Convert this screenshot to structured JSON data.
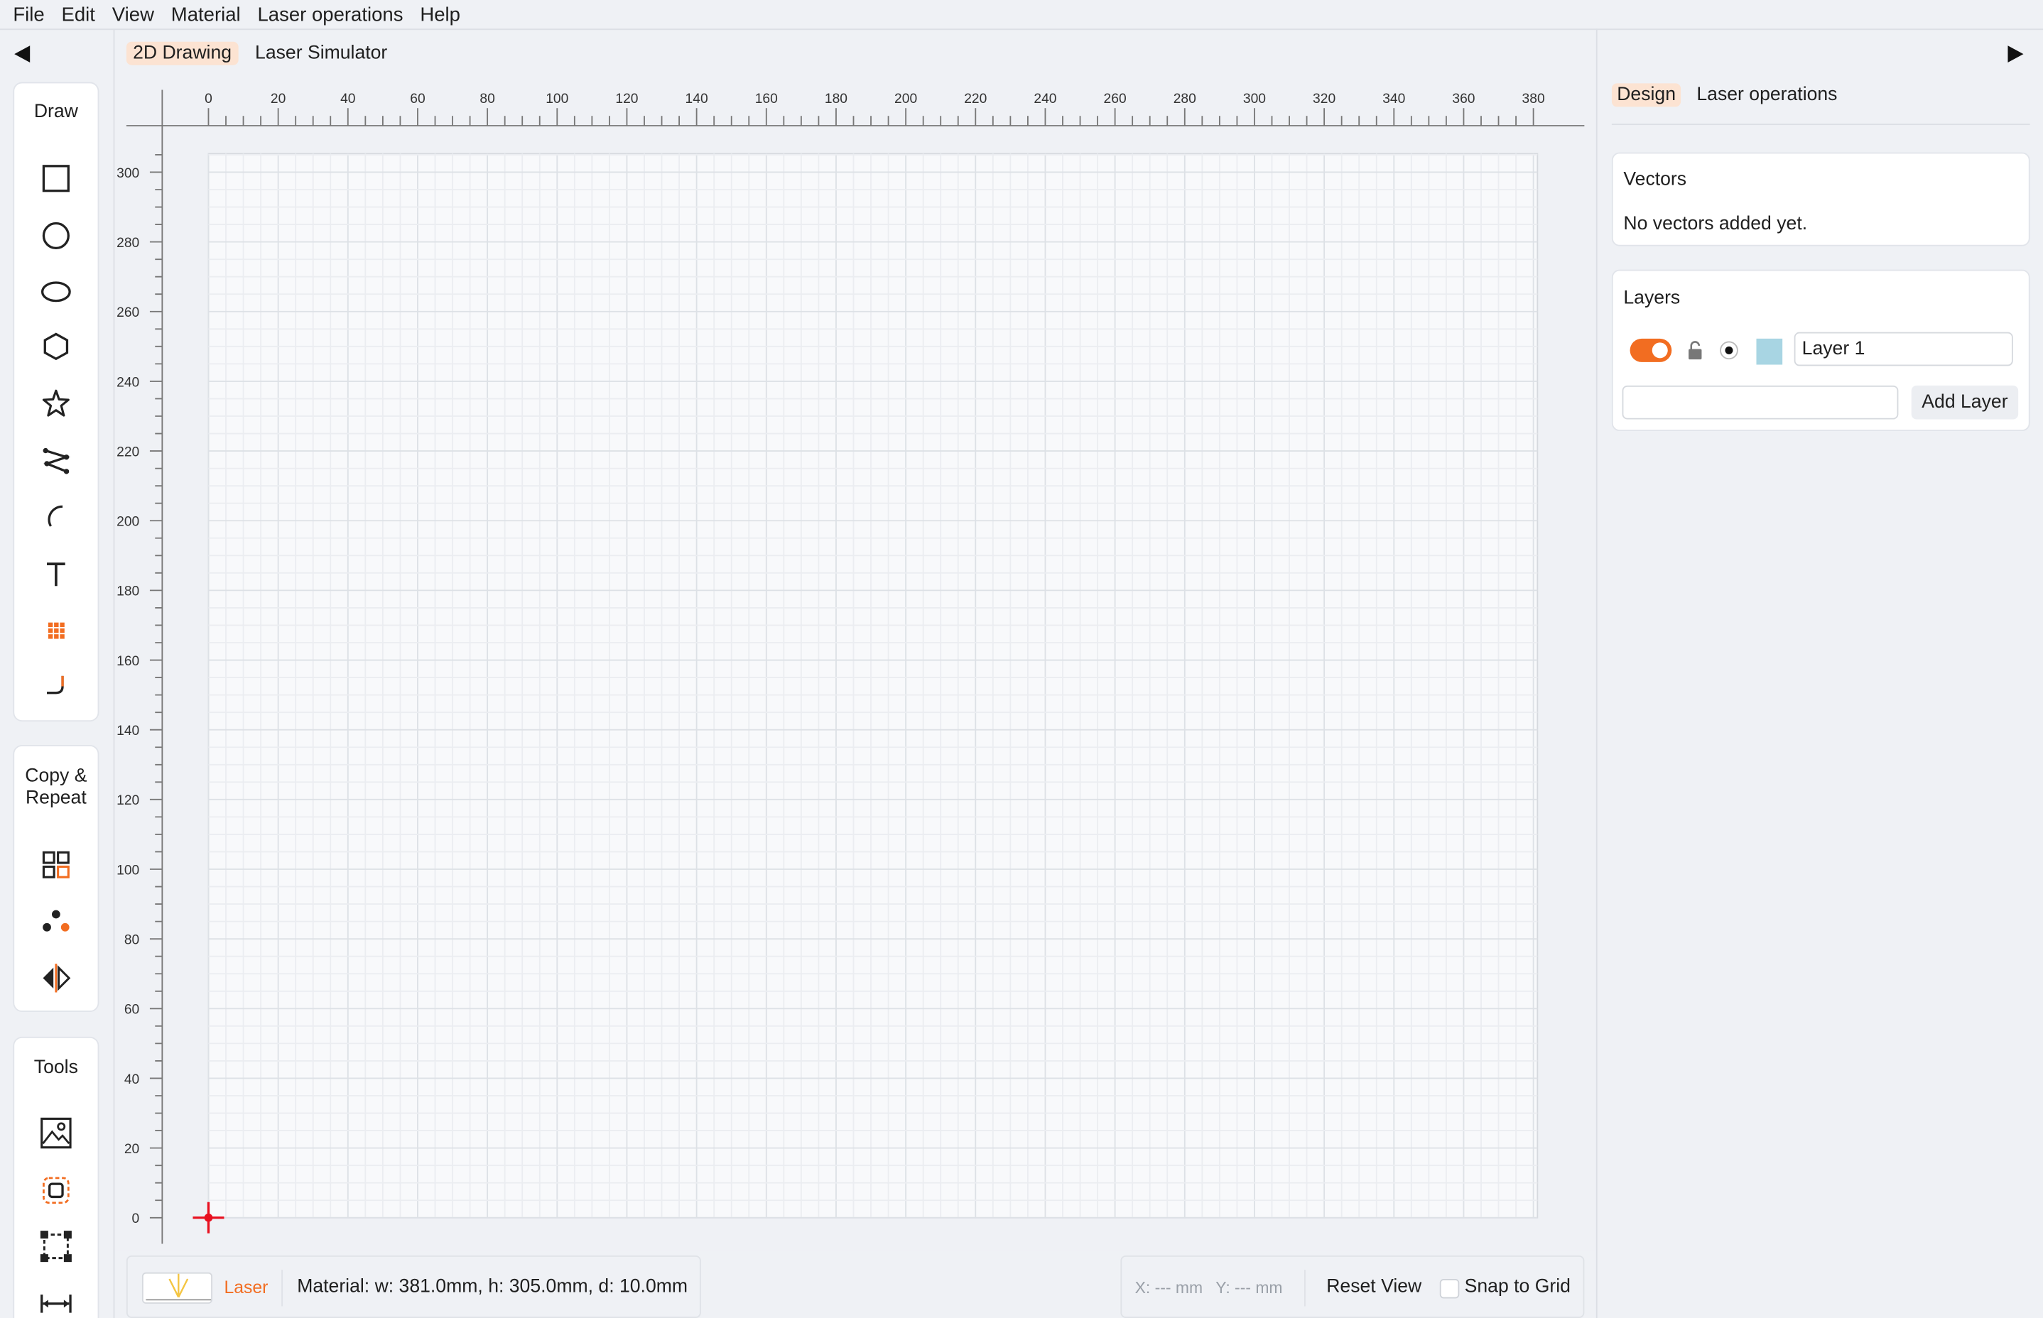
{
  "menu": {
    "items": [
      "File",
      "Edit",
      "View",
      "Material",
      "Laser operations",
      "Help"
    ]
  },
  "view_tabs": {
    "drawing": "2D Drawing",
    "simulator": "Laser Simulator"
  },
  "left_panel": {
    "collapse_icon": "triangle-left-icon",
    "draw": {
      "title": "Draw",
      "tools": [
        "rectangle-icon",
        "circle-icon",
        "ellipse-icon",
        "polygon-icon",
        "star-icon",
        "polyline-icon",
        "arc-icon",
        "text-icon",
        "grid-pattern-icon",
        "corner-curve-icon"
      ]
    },
    "copy_repeat": {
      "title_line1": "Copy &",
      "title_line2": "Repeat",
      "tools": [
        "array-copy-icon",
        "radial-copy-icon",
        "mirror-icon"
      ]
    },
    "tools": {
      "title": "Tools",
      "tools": [
        "image-trace-icon",
        "offset-icon",
        "bounding-box-icon",
        "measure-icon"
      ]
    }
  },
  "canvas": {
    "x_ticks": [
      "0",
      "20",
      "40",
      "60",
      "80",
      "100",
      "120",
      "140",
      "160",
      "180",
      "200",
      "220",
      "240",
      "260",
      "280",
      "300",
      "320",
      "340",
      "360",
      "380"
    ],
    "y_ticks": [
      "300",
      "280",
      "260",
      "240",
      "220",
      "200",
      "180",
      "160",
      "140",
      "120",
      "100",
      "80",
      "60",
      "40",
      "20",
      "0"
    ],
    "origin_marker": "origin-crosshair-icon"
  },
  "status": {
    "laser_label": "Laser",
    "material_text": "Material: w: 381.0mm, h: 305.0mm, d: 10.0mm",
    "coord_x": "X: --- mm",
    "coord_y": "Y: --- mm",
    "reset_view": "Reset View",
    "snap_label": "Snap to Grid",
    "snap_checked": false
  },
  "right_panel": {
    "collapse_icon": "triangle-right-icon",
    "tabs": {
      "design": "Design",
      "laser_ops": "Laser operations"
    },
    "vectors": {
      "title": "Vectors",
      "empty_text": "No vectors added yet."
    },
    "layers": {
      "title": "Layers",
      "items": [
        {
          "name": "Layer 1",
          "color": "#a8d5e3",
          "enabled": true
        }
      ],
      "new_layer_value": "",
      "add_button": "Add Layer"
    }
  },
  "colors": {
    "accent": "#f26d21",
    "active_tab_bg": "#fce3d2",
    "origin_marker": "#e8101f",
    "layer_swatch": "#a8d5e3"
  }
}
